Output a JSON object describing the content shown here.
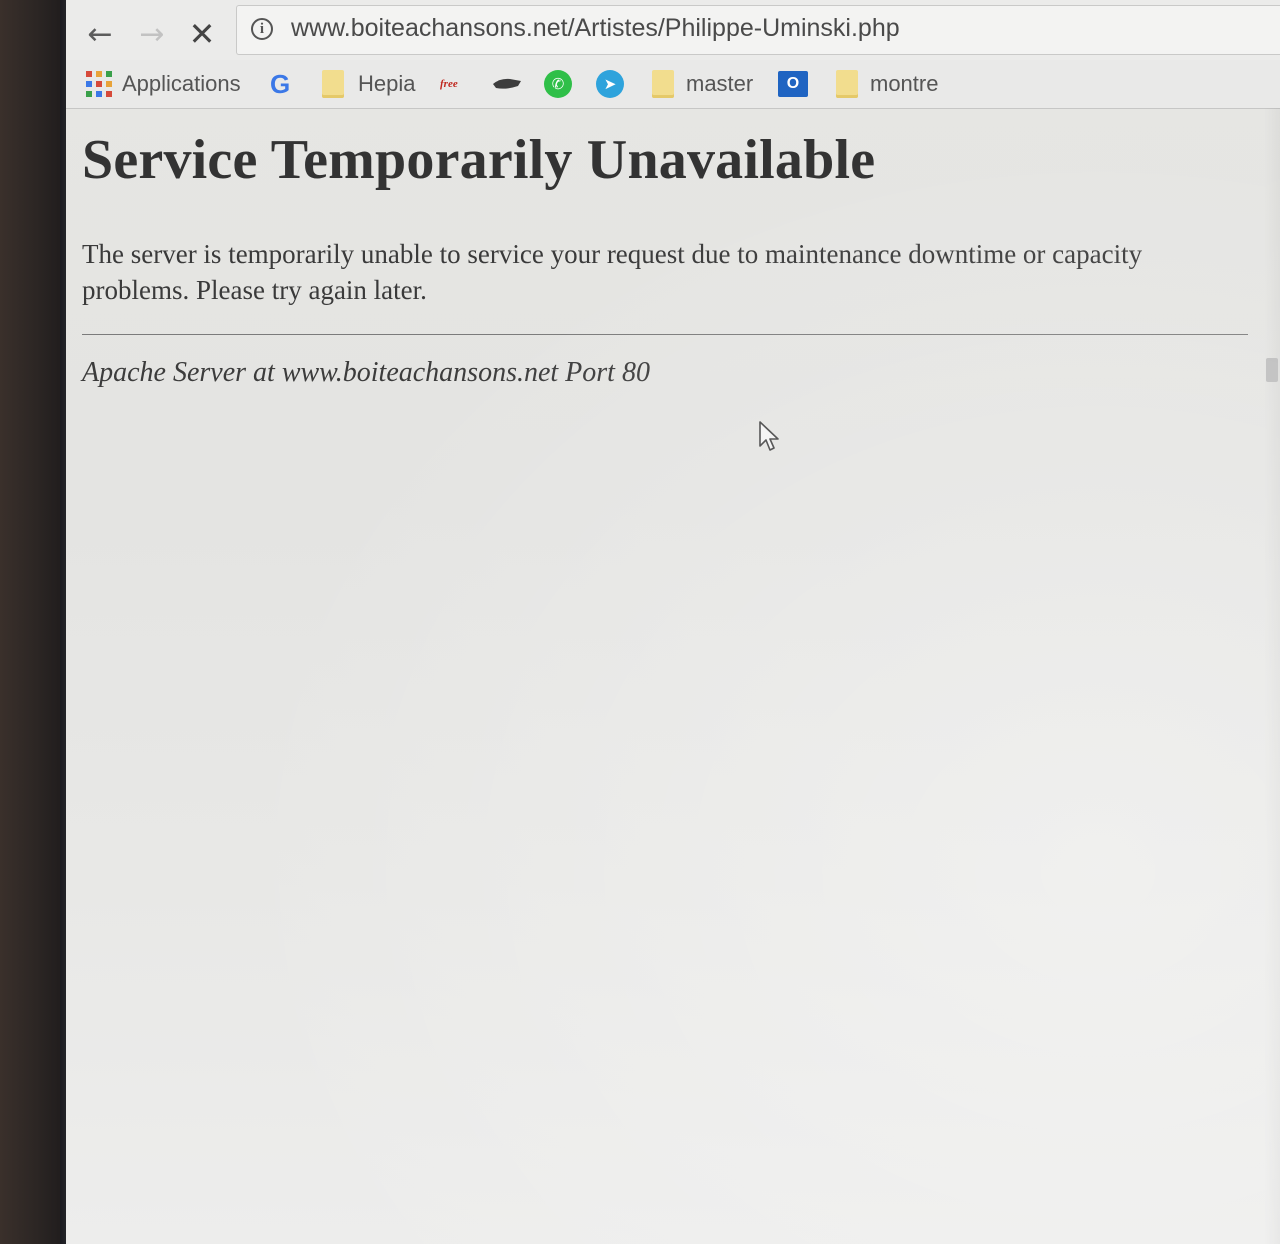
{
  "browser": {
    "url": "www.boiteachansons.net/Artistes/Philippe-Uminski.php",
    "bookmarks": [
      {
        "label": "Applications",
        "icon": "apps-grid-icon"
      },
      {
        "label": "",
        "icon": "google-icon"
      },
      {
        "label": "Hepia",
        "icon": "folder-icon"
      },
      {
        "label": "",
        "icon": "free-logo-icon"
      },
      {
        "label": "",
        "icon": "bookmark-icon"
      },
      {
        "label": "",
        "icon": "whatsapp-icon"
      },
      {
        "label": "",
        "icon": "telegram-icon"
      },
      {
        "label": "master",
        "icon": "folder-icon"
      },
      {
        "label": "",
        "icon": "outlook-icon"
      },
      {
        "label": "montre",
        "icon": "folder-icon"
      }
    ],
    "google_letter": "G",
    "free_text": "free",
    "outlook_letter": "O",
    "colors": {
      "google_blue": "#3b78e7",
      "whatsapp_green": "#2fbf48",
      "telegram_blue": "#2ea3dc",
      "folder_yellow": "#f2dd8e",
      "outlook_blue": "#1f64c2"
    }
  },
  "page": {
    "heading": "Service Temporarily Unavailable",
    "message": "The server is temporarily unable to service your request due to maintenance downtime or capacity problems. Please try again later.",
    "address": "Apache Server at www.boiteachansons.net Port 80"
  }
}
